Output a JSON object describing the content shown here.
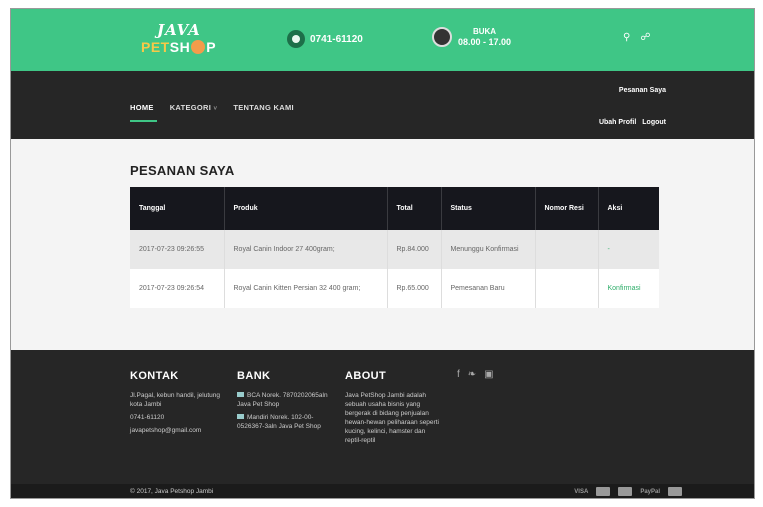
{
  "header": {
    "logo_line1": "JAVA",
    "logo_pet": "PET",
    "logo_shop": "SH",
    "logo_shop_end": "P",
    "phone": "0741-61120",
    "hours_label": "BUKA",
    "hours_value": "08.00 - 17.00",
    "search_icon": "search-icon",
    "cart_icon": "cart-icon"
  },
  "nav": {
    "items": [
      {
        "label": "HOME",
        "active": true
      },
      {
        "label": "KATEGORI",
        "caret": "˅"
      },
      {
        "label": "TENTANG KAMI"
      }
    ],
    "pesanan_saya": "Pesanan Saya",
    "ubah_profil": "Ubah Profil",
    "logout": "Logout"
  },
  "main": {
    "title": "PESANAN SAYA",
    "columns": [
      "Tanggal",
      "Produk",
      "Total",
      "Status",
      "Nomor Resi",
      "Aksi"
    ],
    "rows": [
      {
        "tanggal": "2017-07-23 09:26:55",
        "produk": "Royal Canin Indoor 27 400gram;",
        "total": "Rp.84.000",
        "status": "Menunggu Konfirmasi",
        "resi": "",
        "aksi": "-"
      },
      {
        "tanggal": "2017-07-23 09:26:54",
        "produk": "Royal Canin Kitten Persian 32 400 gram;",
        "total": "Rp.65.000",
        "status": "Pemesanan Baru",
        "resi": "",
        "aksi": "Konfirmasi"
      }
    ]
  },
  "footer": {
    "kontak_title": "KONTAK",
    "kontak_address": "Jl.Pagal, kebun handil, jelutung kota Jambi",
    "kontak_phone": "0741-61120",
    "kontak_email": "javapetshop@gmail.com",
    "bank_title": "BANK",
    "bank_bca": "BCA Norek. 7870202065aln Java Pet Shop",
    "bank_mandiri": "Mandiri Norek. 102-00-0526367-3aln Java Pet Shop",
    "about_title": "ABOUT",
    "about_text": "Java PetShop Jambi adalah sebuah usaha bisnis yang bergerak di bidang penjualan hewan-hewan peliharaan seperti kucing, kelinci, hamster dan reptil-reptil",
    "social_facebook": "f",
    "social_twitter": "🐦",
    "social_instagram": "▣",
    "copyright": "© 2017, Java Petshop Jambi",
    "pay_visa": "VISA",
    "pay_paypal": "PayPal"
  },
  "colors": {
    "brand_green": "#3fc686",
    "dark": "#262626",
    "table_head": "#16171d"
  }
}
